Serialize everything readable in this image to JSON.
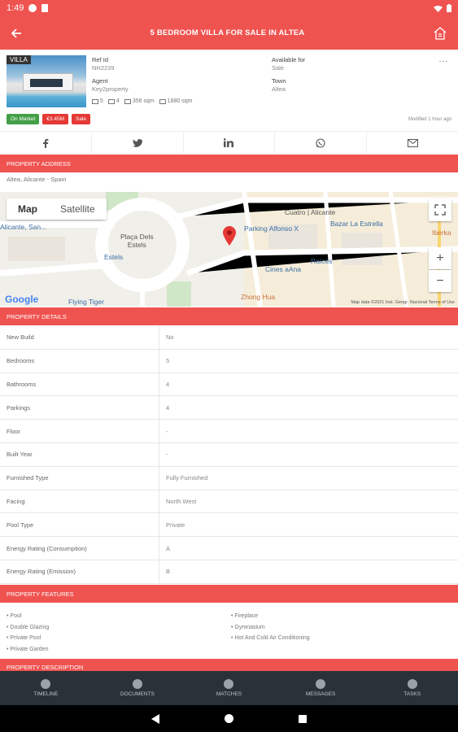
{
  "status_bar": {
    "time": "1:49"
  },
  "app_bar": {
    "title": "5 BEDROOM VILLA FOR SALE IN ALTEA"
  },
  "summary": {
    "badge": "VILLA",
    "ref_label": "Ref Id",
    "ref_value": "NH2239",
    "agent_label": "Agent",
    "agent_value": "Key2property",
    "available_label": "Available for",
    "available_value": "Sale",
    "town_label": "Town",
    "town_value": "Altea",
    "beds": "5",
    "baths": "4",
    "built_area": "356 sqm",
    "plot_area": "1880 sqm",
    "tags": [
      "On Market",
      "€3.45M",
      "Sale"
    ],
    "modified": "Modified 1 hour ago",
    "more": "..."
  },
  "sections": {
    "address": "PROPERTY ADDRESS",
    "details": "PROPERTY DETAILS",
    "features": "PROPERTY FEATURES",
    "description": "PROPERTY DESCRIPTION"
  },
  "address": "Altea, Alicante - Spain",
  "map": {
    "toggle_map": "Map",
    "toggle_satellite": "Satellite",
    "labels": {
      "alicante": "Alicante, San...",
      "placa": "Plaça Dels\nEstels",
      "estels": "Estels",
      "parking": "Parking Alfonso X",
      "cuatro": "Cuatro | Alicante",
      "bazar": "Bazar La Estrella",
      "cines": "Cines aAna",
      "raices": "Raíces",
      "flying": "Flying Tiger",
      "zhong": "Zhong Hua",
      "iberka": "Iberka"
    },
    "footer": "Map data ©2021 Inst. Geogr. Nacional   Terms of Use",
    "google": "Google"
  },
  "details": [
    {
      "key": "New Build",
      "value": "No"
    },
    {
      "key": "Bedrooms",
      "value": "5"
    },
    {
      "key": "Bathrooms",
      "value": "4"
    },
    {
      "key": "Parkings",
      "value": "4"
    },
    {
      "key": "Floor",
      "value": "-"
    },
    {
      "key": "Built Year",
      "value": "-"
    },
    {
      "key": "Furnished Type",
      "value": "Fully Furnished"
    },
    {
      "key": "Facing",
      "value": "North West"
    },
    {
      "key": "Pool Type",
      "value": "Private"
    },
    {
      "key": "Energy Rating (Consumption)",
      "value": "A"
    },
    {
      "key": "Energy Rating (Emission)",
      "value": "B"
    }
  ],
  "features_left": [
    "• Pool",
    "• Double Glazing",
    "• Private Pool",
    "• Private Garden"
  ],
  "features_right": [
    "• Fireplace",
    "• Gymnasium",
    "• Hot And Cold Air Conditioning"
  ],
  "bottom_nav": [
    "TIMELINE",
    "DOCUMENTS",
    "MATCHES",
    "MESSAGES",
    "TASKS"
  ],
  "colors": {
    "accent": "#ef5350",
    "nav_bg": "#283238"
  }
}
